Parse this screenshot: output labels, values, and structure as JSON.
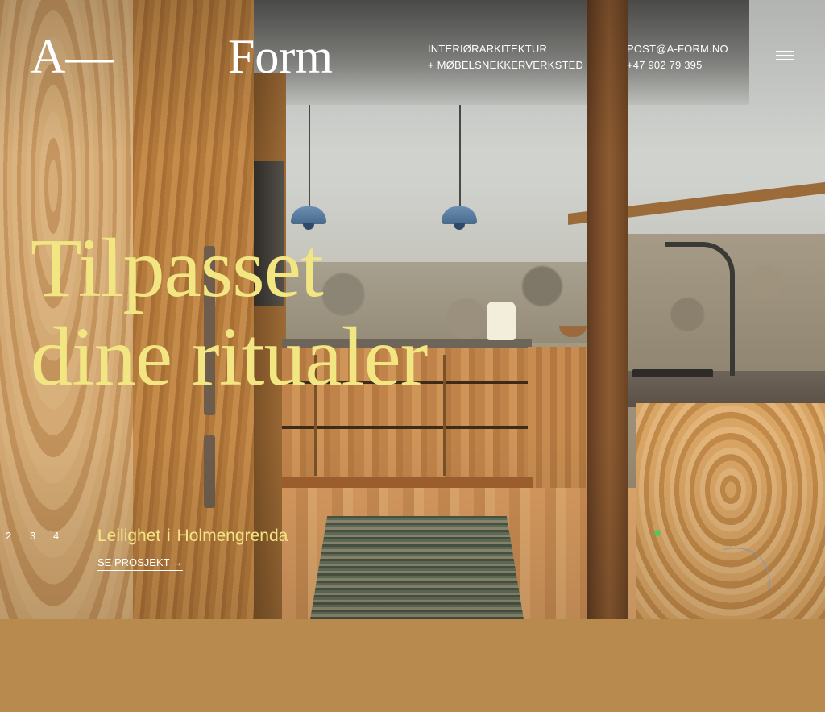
{
  "brand": {
    "logo_left": "A—",
    "logo_right": "Form"
  },
  "nav": {
    "services_line1": "INTERIØRARKITEKTUR",
    "services_line2": "+ MØBELSNEKKERVERKSTED",
    "email": "POST@A-FORM.NO",
    "phone": "+47 902 79 395",
    "menu_icon": "hamburger-menu-icon"
  },
  "hero": {
    "title_line1": "Tilpasset",
    "title_line2": "dine ritualer"
  },
  "slider": {
    "pages": [
      "2",
      "3",
      "4"
    ],
    "project_name": "Leilighet i  Holmengrenda",
    "cta_label": "SE PROSJEKT →"
  },
  "colors": {
    "accent_yellow": "#f2e682",
    "text_white": "#ffffff",
    "indicator_green": "#5cc35a"
  }
}
